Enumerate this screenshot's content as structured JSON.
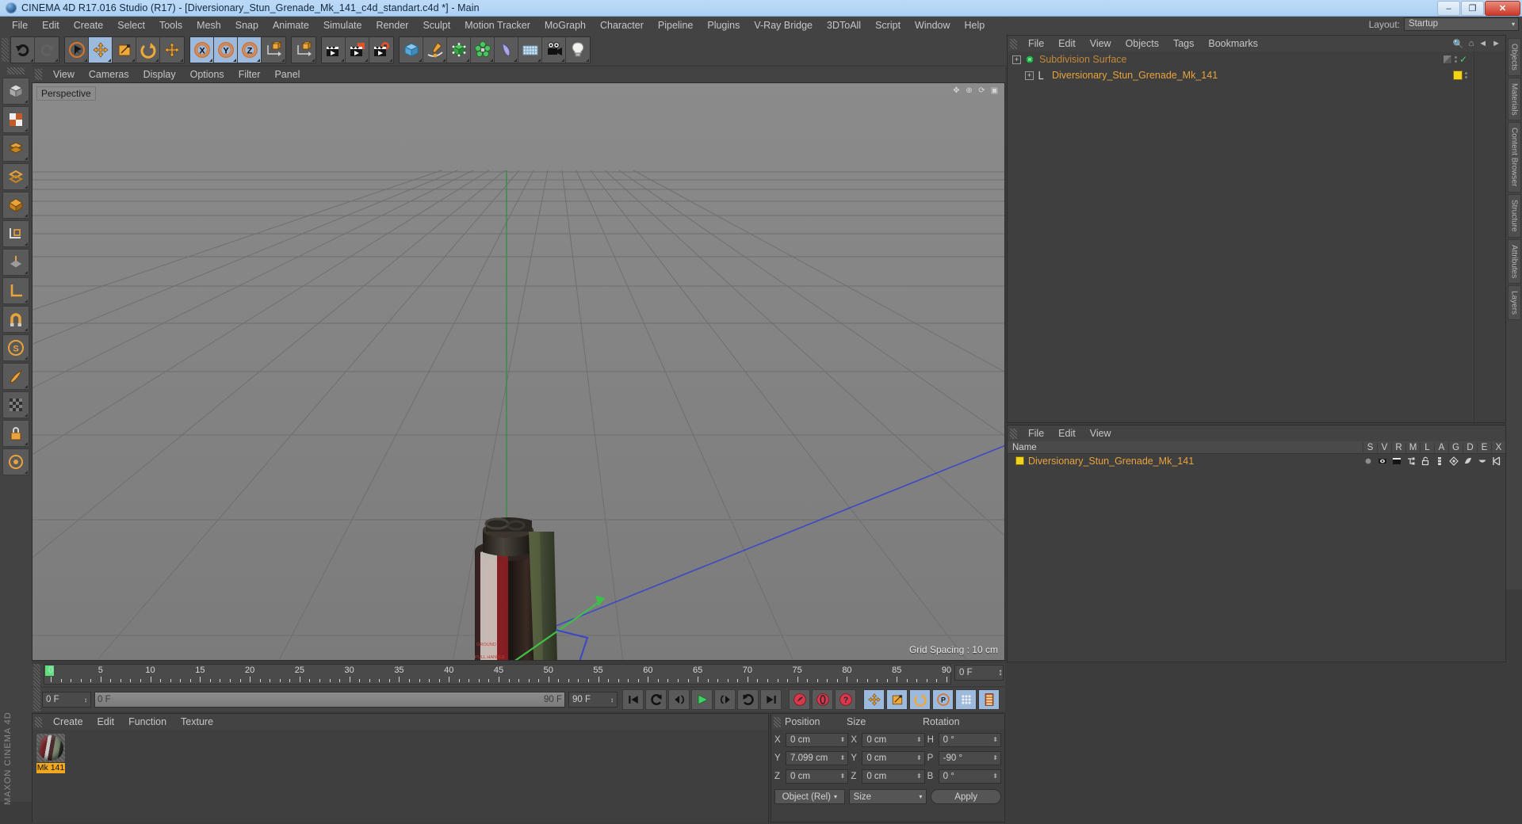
{
  "window": {
    "title": "CINEMA 4D R17.016 Studio (R17) - [Diversionary_Stun_Grenade_Mk_141_c4d_standart.c4d *] - Main",
    "minimize": "–",
    "restore": "❐",
    "close": "✕"
  },
  "menubar": {
    "items": [
      "File",
      "Edit",
      "Create",
      "Select",
      "Tools",
      "Mesh",
      "Snap",
      "Animate",
      "Simulate",
      "Render",
      "Sculpt",
      "Motion Tracker",
      "MoGraph",
      "Character",
      "Pipeline",
      "Plugins",
      "V-Ray Bridge",
      "3DToAll",
      "Script",
      "Window",
      "Help"
    ],
    "layout_label": "Layout:",
    "layout_value": "Startup",
    "layout_arrow": "▾"
  },
  "toolbar": {
    "groups": [
      {
        "name": "undo-redo",
        "buttons": [
          {
            "name": "undo-button",
            "icon": "undo-arrow-icon",
            "state": "normal"
          },
          {
            "name": "redo-button",
            "icon": "redo-arrow-icon",
            "state": "disabled"
          }
        ]
      },
      {
        "name": "transform-tools",
        "buttons": [
          {
            "name": "live-selection-tool",
            "icon": "cursor-circle-icon",
            "state": "normal"
          },
          {
            "name": "move-tool",
            "icon": "move-arrows-icon",
            "state": "active"
          },
          {
            "name": "scale-tool",
            "icon": "scale-box-icon",
            "state": "normal"
          },
          {
            "name": "rotate-tool",
            "icon": "rotate-arc-icon",
            "state": "normal"
          },
          {
            "name": "move-alt-tool",
            "icon": "move-arrows-icon",
            "state": "normal"
          }
        ]
      },
      {
        "name": "axis-locks",
        "buttons": [
          {
            "name": "lock-x-axis-button",
            "icon": "x-axis-icon",
            "state": "active"
          },
          {
            "name": "lock-y-axis-button",
            "icon": "y-axis-icon",
            "state": "active"
          },
          {
            "name": "lock-z-axis-button",
            "icon": "z-axis-icon",
            "state": "active"
          },
          {
            "name": "world-object-axis-button",
            "icon": "world-axis-cube-icon",
            "state": "normal"
          }
        ]
      },
      {
        "name": "coord-system",
        "buttons": [
          {
            "name": "coordinate-system-button",
            "icon": "coordinate-cube-icon",
            "state": "normal"
          }
        ]
      },
      {
        "name": "render-tools",
        "buttons": [
          {
            "name": "render-view-button",
            "icon": "clapboard-icon",
            "state": "normal"
          },
          {
            "name": "render-to-picture-viewer-button",
            "icon": "clapboard-picture-icon",
            "state": "normal"
          },
          {
            "name": "render-settings-button",
            "icon": "clapboard-gear-icon",
            "state": "normal"
          }
        ]
      },
      {
        "name": "create-objects",
        "buttons": [
          {
            "name": "add-cube-button",
            "icon": "cube-icon",
            "state": "normal"
          },
          {
            "name": "add-spline-button",
            "icon": "pen-spline-icon",
            "state": "normal"
          },
          {
            "name": "add-nurbs-button",
            "icon": "green-cube-nurbs-icon",
            "state": "normal"
          },
          {
            "name": "add-array-button",
            "icon": "mograph-cloner-icon",
            "state": "normal"
          },
          {
            "name": "add-deformer-button",
            "icon": "bend-deformer-icon",
            "state": "normal"
          },
          {
            "name": "add-scene-object-button",
            "icon": "floor-grid-icon",
            "state": "normal"
          },
          {
            "name": "add-camera-button",
            "icon": "camera-icon",
            "state": "normal"
          },
          {
            "name": "add-light-button",
            "icon": "lightbulb-icon",
            "state": "normal"
          }
        ]
      }
    ]
  },
  "left_toolbar": {
    "buttons": [
      {
        "name": "model-mode-button",
        "icon": "model-cube-icon"
      },
      {
        "name": "texture-mode-button",
        "icon": "texture-checker-icon"
      },
      {
        "name": "points-mode-button",
        "icon": "points-icon"
      },
      {
        "name": "edges-mode-button",
        "icon": "edges-icon"
      },
      {
        "name": "polygons-mode-button",
        "icon": "polygon-icon"
      },
      {
        "name": "object-axis-button",
        "icon": "axis-cube-icon"
      },
      {
        "name": "workplane-button",
        "icon": "workplane-icon"
      },
      {
        "name": "enable-axis-button",
        "icon": "l-axis-icon"
      },
      {
        "name": "snap-toggle-button",
        "icon": "magnet-icon"
      },
      {
        "name": "snap-settings-button",
        "icon": "s-circle-icon"
      },
      {
        "name": "move-knife-button",
        "icon": "knife-icon"
      },
      {
        "name": "texture-tiles-button",
        "icon": "tiles-icon"
      },
      {
        "name": "lock-button",
        "icon": "lock-icon"
      },
      {
        "name": "viewport-solo-button",
        "icon": "solo-icon"
      }
    ],
    "brand": "MAXON CINEMA 4D"
  },
  "right_tabs": [
    "Objects",
    "Materials",
    "Content Browser",
    "Structure",
    "Attributes",
    "Layers"
  ],
  "viewport": {
    "menu": [
      "View",
      "Cameras",
      "Display",
      "Options",
      "Filter",
      "Panel"
    ],
    "view_label": "Perspective",
    "grid_spacing": "Grid Spacing : 10 cm",
    "nav_icons": [
      "pan-view-icon",
      "zoom-view-icon",
      "rotate-view-icon",
      "maximize-view-icon"
    ]
  },
  "timeline": {
    "ticks": [
      0,
      5,
      10,
      15,
      20,
      25,
      30,
      35,
      40,
      45,
      50,
      55,
      60,
      65,
      70,
      75,
      80,
      85,
      90
    ],
    "current_frame_field": "0 F",
    "end_frame_field": "0 F",
    "scrub_left": "0 F",
    "scrub_right": "90 F",
    "range_field": "90 F",
    "spinner": "↕"
  },
  "transport": {
    "buttons": [
      {
        "name": "go-to-start-button",
        "icon": "skip-start-icon",
        "state": "normal"
      },
      {
        "name": "play-backwards-button",
        "icon": "loop-back-icon",
        "state": "normal"
      },
      {
        "name": "previous-frame-button",
        "icon": "step-back-icon",
        "state": "normal"
      },
      {
        "name": "play-button",
        "icon": "play-icon",
        "state": "normal"
      },
      {
        "name": "next-frame-button",
        "icon": "step-forward-icon",
        "state": "normal"
      },
      {
        "name": "play-forwards-button",
        "icon": "loop-forward-icon",
        "state": "normal"
      },
      {
        "name": "go-to-end-button",
        "icon": "skip-end-icon",
        "state": "normal"
      },
      {
        "name": "record-active-objects-button",
        "icon": "record-key-icon",
        "state": "normal"
      },
      {
        "name": "autokeying-button",
        "icon": "autokey-icon",
        "state": "normal"
      },
      {
        "name": "keyframe-selection-button",
        "icon": "question-key-icon",
        "state": "normal"
      },
      {
        "name": "position-key-button",
        "icon": "move-arrows-icon",
        "state": "active"
      },
      {
        "name": "scale-key-button",
        "icon": "scale-box-icon",
        "state": "active"
      },
      {
        "name": "rotation-key-button",
        "icon": "rotate-arc-icon",
        "state": "active"
      },
      {
        "name": "parameter-key-button",
        "icon": "p-circle-icon",
        "state": "active"
      },
      {
        "name": "point-level-animation-button",
        "icon": "pla-dots-icon",
        "state": "active"
      },
      {
        "name": "timeline-toggle-button",
        "icon": "film-strip-icon",
        "state": "active"
      }
    ]
  },
  "material_manager": {
    "menu": [
      "Create",
      "Edit",
      "Function",
      "Texture"
    ],
    "materials": [
      {
        "name": "Mk 141",
        "preview": "striped-sphere"
      }
    ]
  },
  "coordinates": {
    "headers": [
      "Position",
      "Size",
      "Rotation"
    ],
    "rows": [
      {
        "pos_label": "X",
        "pos_value": "0 cm",
        "size_label": "X",
        "size_value": "0 cm",
        "rot_label": "H",
        "rot_value": "0 °"
      },
      {
        "pos_label": "Y",
        "pos_value": "7.099 cm",
        "size_label": "Y",
        "size_value": "0 cm",
        "rot_label": "P",
        "rot_value": "-90 °"
      },
      {
        "pos_label": "Z",
        "pos_value": "0 cm",
        "size_label": "Z",
        "size_value": "0 cm",
        "rot_label": "B",
        "rot_value": "0 °"
      }
    ],
    "mode_dropdown": "Object (Rel)",
    "size_dropdown": "Size",
    "apply_button": "Apply",
    "dropdown_arrow": "▾"
  },
  "object_manager": {
    "menu": [
      "File",
      "Edit",
      "View",
      "Objects",
      "Tags",
      "Bookmarks"
    ],
    "search_icon": "search-icon",
    "home_icon": "home-icon",
    "back_icon": "back-icon",
    "forward_icon": "forward-icon",
    "rows": [
      {
        "name": "Subdivision Surface",
        "icon": "subdivision-surface-icon",
        "level": 0,
        "dim": true,
        "checked": "✓"
      },
      {
        "name": "Diversionary_Stun_Grenade_Mk_141",
        "icon": "polygon-object-icon",
        "level": 1,
        "dim": false,
        "swatch": "#f2d21a"
      }
    ]
  },
  "layer_manager": {
    "menu": [
      "File",
      "Edit",
      "View"
    ],
    "columns": [
      "Name",
      "S",
      "V",
      "R",
      "M",
      "L",
      "A",
      "G",
      "D",
      "E",
      "X"
    ],
    "rows": [
      {
        "name": "Diversionary_Stun_Grenade_Mk_141",
        "swatch": "#f2d21a"
      }
    ]
  },
  "colors": {
    "accent_orange": "#e8a33d",
    "active_blue": "#9cb9de",
    "panel_bg": "#3f3f3f",
    "chrome_bg": "#434343",
    "viewport_bg": "#7d7d7d",
    "material_label": "#f0a81e"
  }
}
